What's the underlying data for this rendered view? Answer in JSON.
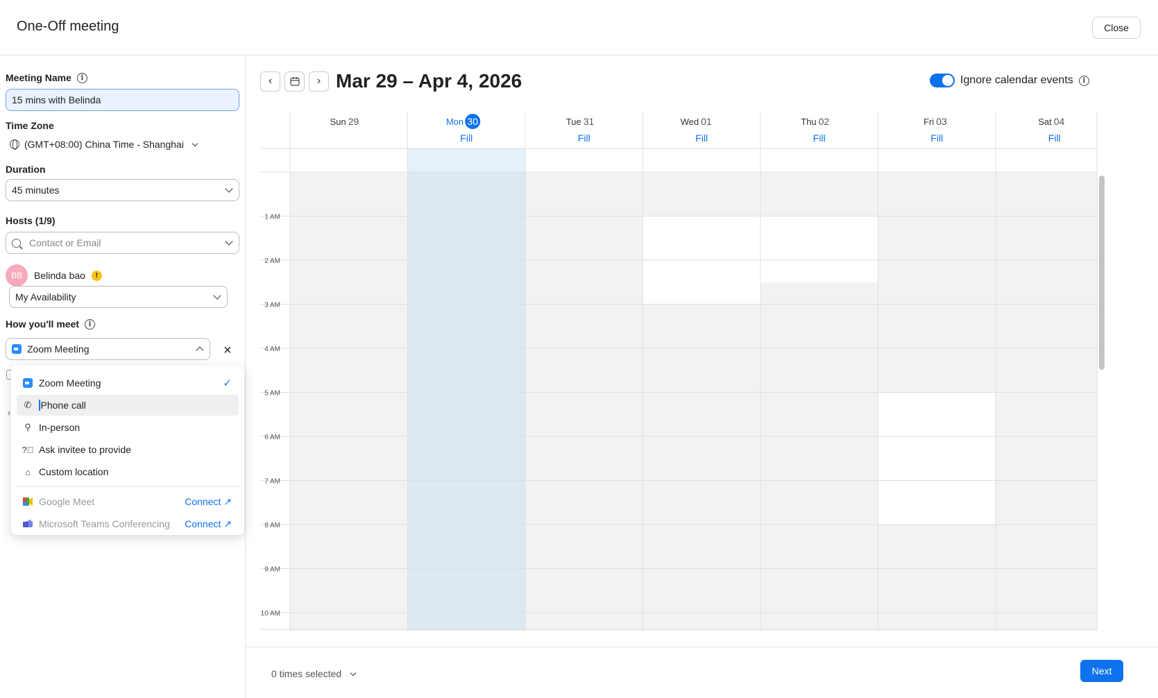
{
  "header": {
    "title": "One-Off meeting",
    "close_label": "Close"
  },
  "form": {
    "meeting_name_label": "Meeting Name",
    "meeting_name_value": "15 mins with Belinda",
    "timezone_label": "Time Zone",
    "timezone_value": "(GMT+08:00) China Time - Shanghai",
    "duration_label": "Duration",
    "duration_value": "45 minutes",
    "hosts_label": "Hosts (1/9)",
    "hosts_placeholder": "Contact or Email",
    "host": {
      "initials": "BB",
      "name": "Belinda bao",
      "warning": "!"
    },
    "availability_value": "My Availability",
    "meet_label": "How you'll meet",
    "meet_value": "Zoom Meeting"
  },
  "dropdown": {
    "options": [
      {
        "label": "Zoom Meeting",
        "icon": "zoom-icon",
        "selected": true
      },
      {
        "label": "Phone call",
        "icon": "phone-icon",
        "highlighted": true
      },
      {
        "label": "In-person",
        "icon": "location-pin-icon"
      },
      {
        "label": "Ask invitee to provide",
        "icon": "question-icon"
      },
      {
        "label": "Custom location",
        "icon": "custom-location-icon"
      }
    ],
    "integrations": [
      {
        "label": "Google Meet",
        "icon": "google-meet-icon",
        "action": "Connect"
      },
      {
        "label": "Microsoft Teams Conferencing",
        "icon": "teams-icon",
        "action": "Connect"
      }
    ]
  },
  "calendar": {
    "range_title": "Mar 29 – Apr 4, 2026",
    "ignore_label": "Ignore calendar events",
    "fill_label": "Fill",
    "days": [
      {
        "dow": "Sun",
        "date": "29",
        "today": false,
        "fill": false
      },
      {
        "dow": "Mon",
        "date": "30",
        "today": true,
        "fill": true
      },
      {
        "dow": "Tue",
        "date": "31",
        "today": false,
        "fill": true
      },
      {
        "dow": "Wed",
        "date": "01",
        "today": false,
        "fill": true
      },
      {
        "dow": "Thu",
        "date": "02",
        "today": false,
        "fill": true
      },
      {
        "dow": "Fri",
        "date": "03",
        "today": false,
        "fill": true
      },
      {
        "dow": "Sat",
        "date": "04",
        "today": false,
        "fill": true
      }
    ],
    "hours": [
      "1 AM",
      "2 AM",
      "3 AM",
      "4 AM",
      "5 AM",
      "6 AM",
      "7 AM",
      "8 AM",
      "9 AM",
      "10 AM"
    ],
    "available_slots": [
      {
        "day": 3,
        "start": 1,
        "end": 3
      },
      {
        "day": 4,
        "start": 1,
        "end": 2.5
      },
      {
        "day": 5,
        "start": 5,
        "end": 8
      }
    ],
    "colors": {
      "accent": "#0e72ed",
      "unavailable": "#f2f2f2",
      "today_col": "#dde9f2",
      "today_top": "#e4f1fb"
    }
  },
  "footer": {
    "selected_label": "0 times selected",
    "next_label": "Next"
  }
}
